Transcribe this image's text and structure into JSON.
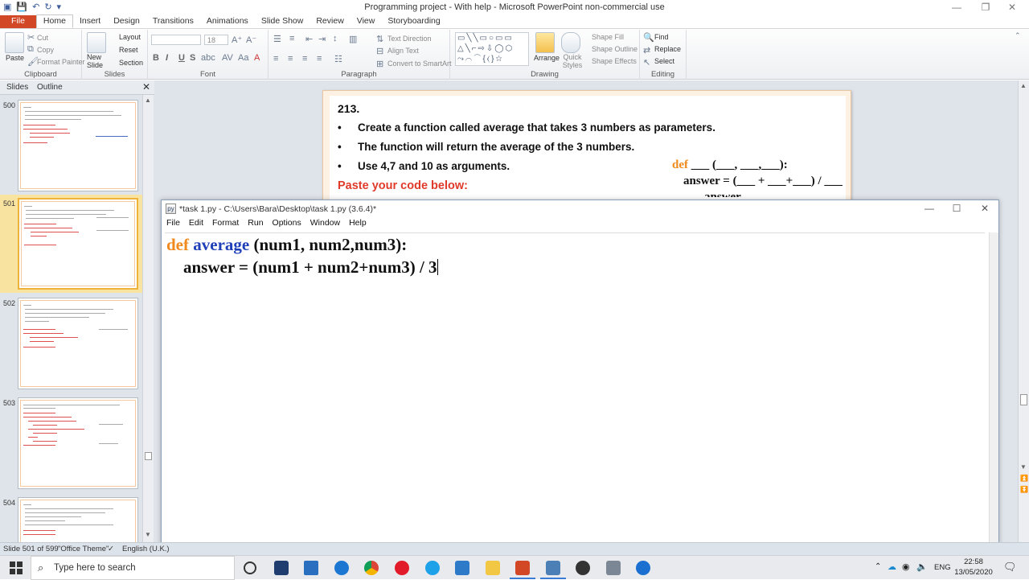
{
  "ppt": {
    "window_title": "Programming project - With help  -  Microsoft PowerPoint non-commercial use",
    "tabs": [
      "File",
      "Home",
      "Insert",
      "Design",
      "Transitions",
      "Animations",
      "Slide Show",
      "Review",
      "View",
      "Storyboarding"
    ],
    "ribbon": {
      "clipboard": {
        "label": "Clipboard",
        "paste": "Paste",
        "cut": "Cut",
        "copy": "Copy",
        "format_painter": "Format Painter"
      },
      "slides": {
        "label": "Slides",
        "new_slide": "New Slide",
        "layout": "Layout",
        "reset": "Reset",
        "section": "Section"
      },
      "font": {
        "label": "Font",
        "size": "18"
      },
      "paragraph": {
        "label": "Paragraph",
        "text_direction": "Text Direction",
        "align_text": "Align Text",
        "smartart": "Convert to SmartArt"
      },
      "drawing": {
        "label": "Drawing",
        "arrange": "Arrange",
        "quick_styles": "Quick Styles",
        "shape_fill": "Shape Fill",
        "shape_outline": "Shape Outline",
        "shape_effects": "Shape Effects"
      },
      "editing": {
        "label": "Editing",
        "find": "Find",
        "replace": "Replace",
        "select": "Select"
      }
    },
    "panel_tabs": {
      "slides": "Slides",
      "outline": "Outline"
    },
    "thumbnails": [
      "500",
      "501",
      "502",
      "503",
      "504"
    ],
    "slide": {
      "title": "213.",
      "bullets": [
        "Create a function called average that takes 3 numbers as parameters.",
        "The function will return the average of the 3 numbers.",
        "Use 4,7 and 10 as arguments."
      ],
      "paste": "Paste your code below:",
      "template_def_kw": "def",
      "template_def_rest": " ___ (___, ___,___):",
      "template_answer": "answer = (___ + ___+___) / ___",
      "template_partial": "answer"
    },
    "status": {
      "slide": "Slide 501 of 599",
      "theme": "\"Office Theme\"",
      "language": "English (U.K.)"
    }
  },
  "idle": {
    "title": "*task 1.py - C:\\Users\\Bara\\Desktop\\task 1.py (3.6.4)*",
    "menu": [
      "File",
      "Edit",
      "Format",
      "Run",
      "Options",
      "Window",
      "Help"
    ],
    "code": {
      "line1_kw": "def",
      "line1_fn": "average",
      "line1_rest": " (num1, num2,num3):",
      "line2": "    answer = (num1 + num2+num3) / 3"
    }
  },
  "taskbar": {
    "search_placeholder": "Type here to search",
    "language": "ENG",
    "time": "22:58",
    "date": "13/05/2020"
  }
}
